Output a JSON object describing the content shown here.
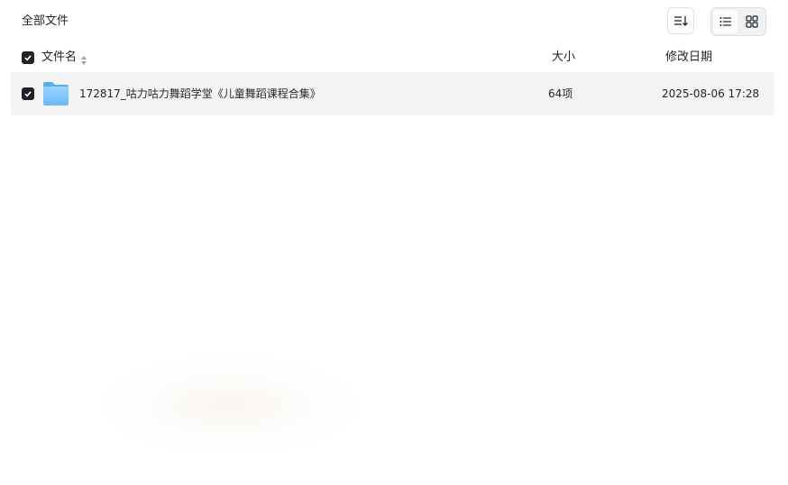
{
  "header": {
    "breadcrumb": "全部文件",
    "sort_icon": "sort-list-icon",
    "view_options": [
      {
        "name": "list-view",
        "icon": "list-icon",
        "active": true
      },
      {
        "name": "grid-view",
        "icon": "grid-icon",
        "active": false
      }
    ]
  },
  "columns": {
    "name": "文件名",
    "size": "大小",
    "date": "修改日期"
  },
  "files": [
    {
      "name": "172817_咕力咕力舞蹈学堂《儿童舞蹈课程合集》",
      "size": "64项",
      "modified": "2025-08-06 17:28",
      "icon": "folder-icon",
      "checked": true
    }
  ],
  "colors": {
    "accent": "#1f2329",
    "folder": "#7cc4f8",
    "row_highlight": "#f4f4f5"
  }
}
